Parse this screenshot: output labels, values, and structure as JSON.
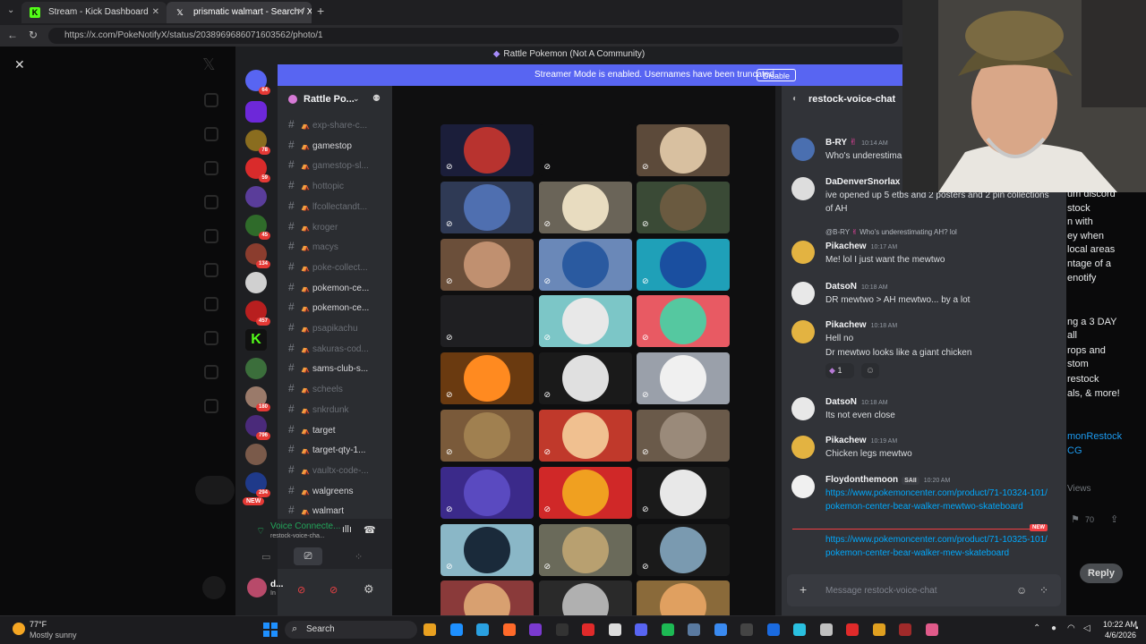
{
  "browser": {
    "tabs": [
      {
        "label": "Stream - Kick Dashboard",
        "icon": "kick-icon"
      },
      {
        "label": "prismatic walmart - Search / X",
        "icon": "x-icon"
      }
    ],
    "url": "https://x.com/PokeNotifyX/status/2038969686071603562/photo/1"
  },
  "discord": {
    "window_title": "Rattle Pokemon (Not A Community)",
    "streamer_banner": "Streamer Mode is enabled. Usernames have been truncated.",
    "disable_label": "Disable",
    "server_name": "Rattle Po...",
    "server_badges": [
      "64",
      "78",
      "59",
      "45",
      "134",
      "457",
      "180",
      "796",
      "294",
      "NEW"
    ],
    "channels": [
      {
        "name": "exp-share-c...",
        "dim": true
      },
      {
        "name": "gamestop",
        "dim": false
      },
      {
        "name": "gamestop-sl...",
        "dim": true
      },
      {
        "name": "hottopic",
        "dim": true
      },
      {
        "name": "lfcollectandt...",
        "dim": true
      },
      {
        "name": "kroger",
        "dim": true
      },
      {
        "name": "macys",
        "dim": true
      },
      {
        "name": "poke-collect...",
        "dim": true
      },
      {
        "name": "pokemon-ce...",
        "dim": false
      },
      {
        "name": "pokemon-ce...",
        "dim": false
      },
      {
        "name": "psapikachu",
        "dim": true
      },
      {
        "name": "sakuras-cod...",
        "dim": true
      },
      {
        "name": "sams-club-s...",
        "dim": false
      },
      {
        "name": "scheels",
        "dim": true
      },
      {
        "name": "snkrdunk",
        "dim": true
      },
      {
        "name": "target",
        "dim": false
      },
      {
        "name": "target-qty-1...",
        "dim": false
      },
      {
        "name": "vaultx-code-...",
        "dim": true
      },
      {
        "name": "walgreens",
        "dim": false
      },
      {
        "name": "walmart",
        "dim": false
      }
    ],
    "voice": {
      "status": "Voice Connecte...",
      "channel": "restock-voice-cha..."
    },
    "user": {
      "name": "d...",
      "status": "In"
    },
    "chat": {
      "channel": "restock-voice-chat",
      "messages": [
        {
          "author": "B-RY",
          "time": "10:14 AM",
          "text": "Who's underestima"
        },
        {
          "author": "DaDenverSnorlax",
          "time": "",
          "text": "ive opened up 5 etbs and 2 posters and 2 pin collections of AH"
        },
        {
          "reply": "@B-RY",
          "reply_text": "Who's underestimating AH? lol",
          "author": "Pikachew",
          "time": "10:17 AM",
          "text": "Me! lol I just want the mewtwo"
        },
        {
          "author": "DatsoN",
          "time": "10:18 AM",
          "text": "DR mewtwo > AH mewtwo... by a lot"
        },
        {
          "author": "Pikachew",
          "time": "10:18 AM",
          "text": "Hell no",
          "text2": "Dr mewtwo looks like a giant chicken",
          "reaction_count": "1"
        },
        {
          "author": "DatsoN",
          "time": "10:18 AM",
          "text": "Its not even close"
        },
        {
          "author": "Pikachew",
          "time": "10:19 AM",
          "text": "Chicken legs mewtwo"
        },
        {
          "author": "Floydonthemoon",
          "tag": "SAII",
          "time": "10:20 AM",
          "text": "https://www.pokemoncenter.com/product/71-10324-101/pokemon-center-bear-walker-mewtwo-skateboard"
        },
        {
          "author": "",
          "time": "",
          "text": "https://www.pokemoncenter.com/product/71-10325-101/pokemon-center-bear-walker-mew-skateboard"
        }
      ],
      "new_label": "NEW",
      "input_placeholder": "Message restock-voice-chat"
    }
  },
  "x_side": {
    "lines": [
      "um discord",
      "stock",
      "n with",
      "ey when",
      "local areas",
      "ntage of a",
      "enotify",
      "ng a 3 DAY",
      "all",
      "rops and",
      "stom",
      "restock",
      "als, & more!"
    ],
    "link1": "monRestock",
    "link2": "CG",
    "views": "Views",
    "count": "70",
    "reply": "Reply"
  },
  "taskbar": {
    "weather_temp": "77°F",
    "weather_desc": "Mostly sunny",
    "search": "Search",
    "time": "10:22 AM",
    "date": "4/6/2026"
  }
}
